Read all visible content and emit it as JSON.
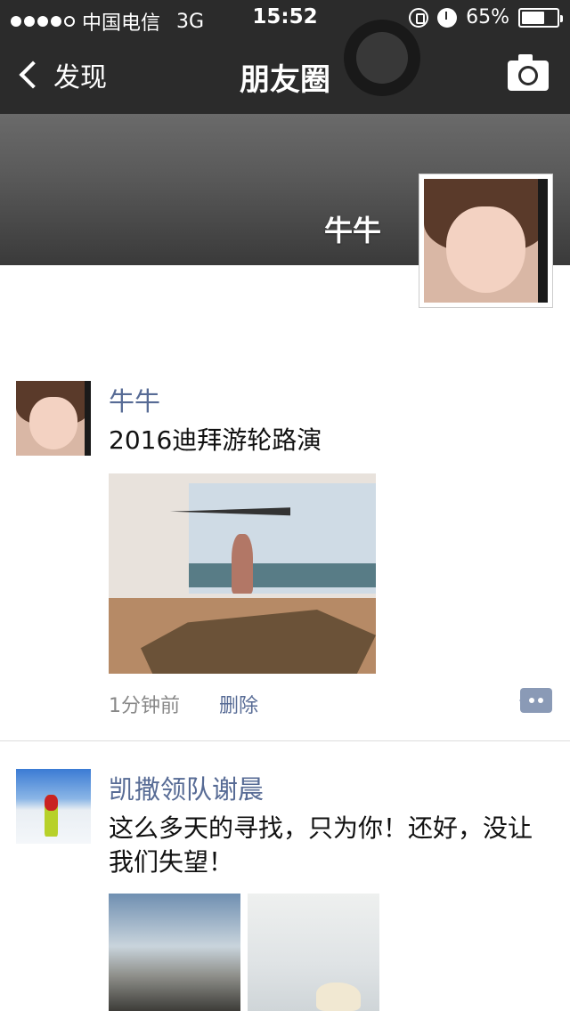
{
  "status_bar": {
    "carrier": "中国电信",
    "network": "3G",
    "time": "15:52",
    "battery_percent_label": "65%",
    "battery_level": 0.65,
    "icons": [
      "signal-dots-icon",
      "orientation-lock-icon",
      "alarm-icon",
      "battery-icon"
    ]
  },
  "nav": {
    "back_label": "发现",
    "title": "朋友圈",
    "right_icon": "camera-icon"
  },
  "cover": {
    "name": "牛牛"
  },
  "posts": [
    {
      "name": "牛牛",
      "text": "2016迪拜游轮路演",
      "time": "1分钟前",
      "delete_label": "删除"
    },
    {
      "name": "凯撒领队谢晨",
      "text": "这么多天的寻找，只为你！还好，没让我们失望！"
    }
  ],
  "colors": {
    "nav_bg": "#2b2b2b",
    "link_blue": "#576b95",
    "comment_btn": "#8a9ab6"
  }
}
